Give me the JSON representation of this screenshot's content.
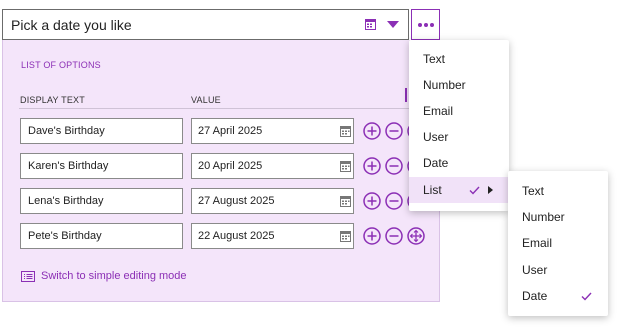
{
  "field": {
    "value": "Pick a date you like"
  },
  "panel": {
    "title": "LIST OF OPTIONS",
    "columns": {
      "display_text": "DISPLAY TEXT",
      "value": "VALUE"
    },
    "rows": [
      {
        "display": "Dave's Birthday",
        "value": "27 April 2025"
      },
      {
        "display": "Karen's Birthday",
        "value": "20 April 2025"
      },
      {
        "display": "Lena's Birthday",
        "value": "27 August 2025"
      },
      {
        "display": "Pete's Birthday",
        "value": "22 August 2025"
      }
    ],
    "switch_mode": "Switch to simple editing mode"
  },
  "type_menu": {
    "items": [
      "Text",
      "Number",
      "Email",
      "User",
      "Date",
      "List"
    ],
    "checked": "List"
  },
  "list_submenu": {
    "items": [
      "Text",
      "Number",
      "Email",
      "User",
      "Date"
    ],
    "checked": "Date"
  },
  "icons": {
    "field_calendar": "calendar-icon",
    "field_dropdown": "caret-down-icon",
    "more": "more-dots-icon",
    "row_calendar": "calendar-icon",
    "add": "add-circle-icon",
    "remove": "remove-circle-icon",
    "move": "move-circle-icon",
    "switch_mode": "list-mode-icon",
    "check": "checkmark-icon",
    "submenu": "chevron-right-icon"
  },
  "colors": {
    "accent": "#8b2fb5",
    "panel_bg": "#f4e5fa",
    "menu_highlight": "#f1e2f8"
  }
}
